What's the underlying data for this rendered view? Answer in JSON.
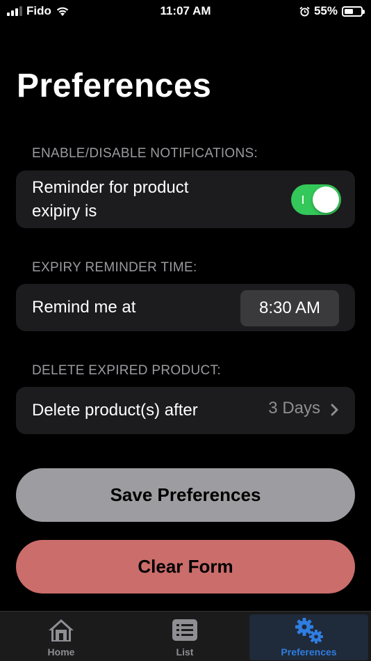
{
  "status_bar": {
    "carrier": "Fido",
    "time": "11:07 AM",
    "battery_percent": "55%",
    "battery_level": 0.55,
    "icons": [
      "signal-icon",
      "wifi-icon",
      "alarm-icon",
      "battery-icon"
    ]
  },
  "page": {
    "title": "Preferences"
  },
  "notifications": {
    "header": "ENABLE/DISABLE NOTIFICATIONS:",
    "label_line1": "Reminder for product",
    "label_line2": "exipiry is",
    "toggle_on": true,
    "toggle_color": "#34c759"
  },
  "reminder_time": {
    "header": "EXPIRY REMINDER TIME:",
    "label": "Remind me at",
    "value": "8:30 AM"
  },
  "delete_expired": {
    "header": "DELETE EXPIRED PRODUCT:",
    "label": "Delete product(s) after",
    "value": "3 Days"
  },
  "actions": {
    "save_label": "Save Preferences",
    "save_color": "#9d9da1",
    "clear_label": "Clear Form",
    "clear_color": "#ca6d6b"
  },
  "tab_bar": {
    "tabs": [
      {
        "label": "Home",
        "icon": "home-icon",
        "active": false
      },
      {
        "label": "List",
        "icon": "list-icon",
        "active": false
      },
      {
        "label": "Preferences",
        "icon": "gears-icon",
        "active": true
      }
    ],
    "active_color": "#2f7de1"
  }
}
